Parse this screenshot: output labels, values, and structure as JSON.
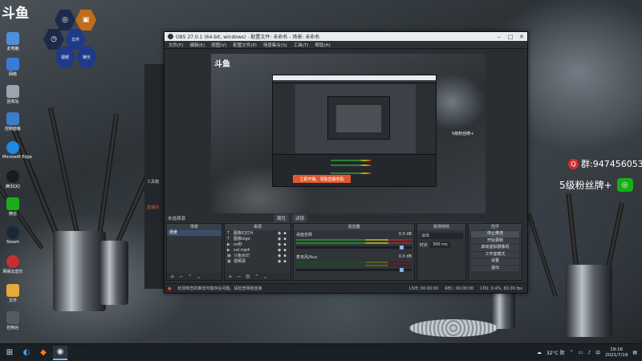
{
  "desktop": {
    "brand_logo": "斗鱼",
    "hex_menu": [
      {
        "label": "",
        "icon": "app-icon"
      },
      {
        "label": "",
        "icon": "media-icon"
      },
      {
        "label": "",
        "icon": "clock-icon"
      },
      {
        "label": "文件",
        "icon": "file-icon"
      },
      {
        "label": "视频",
        "icon": "video-icon"
      },
      {
        "label": "娱乐",
        "icon": "game-icon"
      }
    ],
    "icons": [
      {
        "label": "此电脑",
        "icon": "computer-icon",
        "color": "#4f8fd9"
      },
      {
        "label": "网络",
        "icon": "network-icon",
        "color": "#3a7bd5"
      },
      {
        "label": "回收站",
        "icon": "recycle-bin-icon",
        "color": "#9aa5b1"
      },
      {
        "label": "控制面板",
        "icon": "control-panel-icon",
        "color": "#3d7cc9"
      },
      {
        "label": "Microsoft Edge",
        "icon": "edge-icon",
        "color": "#1e88e5"
      },
      {
        "label": "腾讯QQ",
        "icon": "qq-icon",
        "color": "#1b1b1b"
      },
      {
        "label": "微信",
        "icon": "wechat-icon",
        "color": "#1aad19"
      },
      {
        "label": "Steam",
        "icon": "steam-icon",
        "color": "#1b2838"
      },
      {
        "label": "网易云音乐",
        "icon": "music-icon",
        "color": "#c62f2f"
      },
      {
        "label": "文件",
        "icon": "folder-icon",
        "color": "#e8a93b"
      },
      {
        "label": "控制台",
        "icon": "console-icon",
        "color": "#555b61"
      }
    ]
  },
  "obs": {
    "title": "OBS 27.0.1 (64-bit, windows) - 配置文件: 未命名 - 场景: 未命名",
    "menu": [
      "文件(F)",
      "编辑(E)",
      "视图(V)",
      "配置文件(P)",
      "场景集合(S)",
      "工具(T)",
      "帮助(H)"
    ],
    "window_buttons": [
      "–",
      "□",
      "✕"
    ],
    "side_labels": [
      "工具箱",
      "直播间"
    ],
    "preview_overlay": {
      "banner": "立即开播，领取直播奖励",
      "fans_text": "5级粉丝牌+"
    },
    "dock_row": {
      "label": "未选择源",
      "tag1": "属性",
      "tag2": "滤镜"
    },
    "docks": {
      "scenes": {
        "title": "场景",
        "items": [
          "场景"
        ]
      },
      "sources": {
        "title": "来源",
        "items": [
          "图像幻灯片",
          "图像logo",
          "xx秒",
          "xxl.mp4",
          "斗鱼水印",
          "视频源"
        ],
        "icons": [
          "T",
          "T",
          "▶",
          "▶",
          "▣",
          "▣"
        ]
      },
      "mixer": {
        "title": "混音器",
        "channels": [
          {
            "name": "桌面音频",
            "db": "0.0 dB"
          },
          {
            "name": "麦克风/Aux",
            "db": "0.0 dB"
          }
        ]
      },
      "transitions": {
        "title": "转场特效",
        "type": "淡出",
        "duration_label": "时长",
        "duration": "300 ms"
      },
      "controls": {
        "title": "控件",
        "buttons": [
          "停止推流",
          "开始录制",
          "启动虚拟摄像机",
          "工作室模式",
          "设置",
          "退出"
        ]
      }
    },
    "status": {
      "notice": "检测到您的推流可能存在问题，请检查网络连接",
      "live": "LIVE: 00:00:00",
      "rec": "REC: 00:00:00",
      "cpu": "CPU: 0.4%, 60.00 fps"
    }
  },
  "overlay_right": {
    "qq_text": "群:947456053",
    "fans_text": "5级粉丝牌+"
  },
  "taskbar": {
    "weather": "32°C 阴",
    "time": "19:16",
    "date": "2021/7/19"
  }
}
